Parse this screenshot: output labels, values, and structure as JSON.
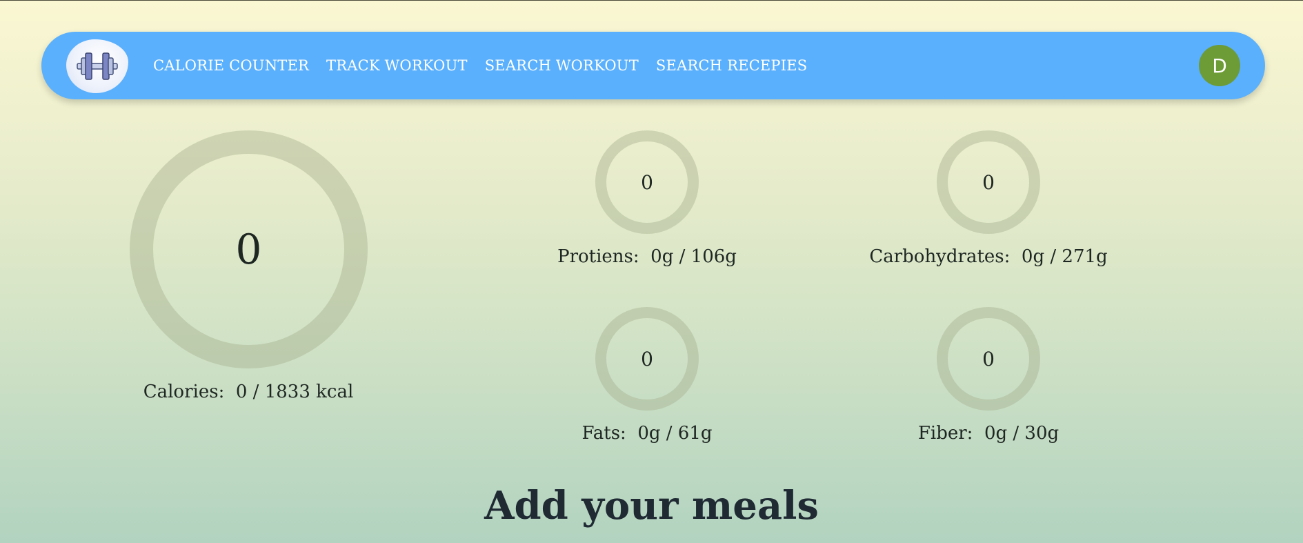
{
  "nav": {
    "logo": "dumbbell-icon",
    "links": [
      "CALORIE COUNTER",
      "TRACK WORKOUT",
      "SEARCH WORKOUT",
      "SEARCH RECEPIES"
    ],
    "avatar_initial": "D"
  },
  "stats": {
    "calories": {
      "value": "0",
      "label": "Calories:",
      "amount": "0 / 1833 kcal",
      "progress": 0
    },
    "protiens": {
      "value": "0",
      "label": "Protiens:",
      "amount": "0g / 106g",
      "progress": 0
    },
    "carbohydrates": {
      "value": "0",
      "label": "Carbohydrates:",
      "amount": "0g / 271g",
      "progress": 0
    },
    "fats": {
      "value": "0",
      "label": "Fats:",
      "amount": "0g / 61g",
      "progress": 0
    },
    "fiber": {
      "value": "0",
      "label": "Fiber:",
      "amount": "0g / 30g",
      "progress": 0
    }
  },
  "heading": "Add your meals",
  "colors": {
    "navbar": "#5ab0fd",
    "avatar": "#6d9b36",
    "ring_track": "#c5c8a8",
    "heading": "#1f2a33"
  }
}
